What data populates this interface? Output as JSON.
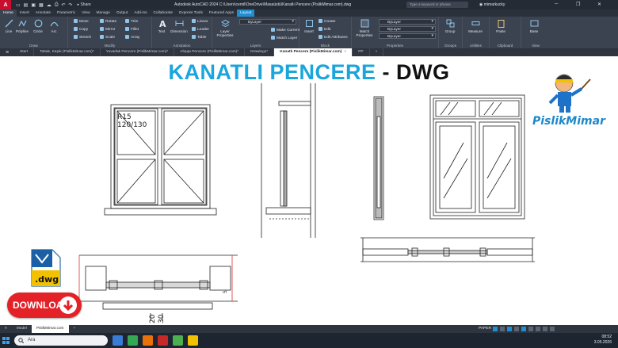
{
  "app": {
    "window_title": "Autodesk AutoCAD 2024   C:\\Users\\cemil\\OneDrive\\Masaüstü\\Kanatlı Pencere (PislikMimar.com).dwg",
    "search_placeholder": "Type a keyword or phrase",
    "user": "mimarkucky",
    "share_label": "Share",
    "logo_letter": "A"
  },
  "ribbon_tabs": [
    "Home",
    "Insert",
    "Annotate",
    "Parametric",
    "View",
    "Manage",
    "Output",
    "Add-ins",
    "Collaborate",
    "Express Tools",
    "Featured Apps",
    "Layout"
  ],
  "ribbon": {
    "draw": {
      "title": "Draw",
      "buttons": [
        "Line",
        "Polyline",
        "Circle",
        "Arc"
      ]
    },
    "modify": {
      "title": "Modify",
      "buttons": [
        "Move",
        "Rotate",
        "Trim",
        "Copy",
        "Mirror",
        "Fillet",
        "Stretch",
        "Scale",
        "Array"
      ]
    },
    "annotation": {
      "title": "Annotation",
      "buttons": [
        "Text",
        "Dimension",
        "Linear",
        "Leader",
        "Table"
      ]
    },
    "layers": {
      "title": "Layers",
      "buttons": [
        "Layer Properties",
        "Make Current",
        "Match Layer"
      ]
    },
    "block": {
      "title": "Block",
      "buttons": [
        "Insert",
        "Create",
        "Edit",
        "Edit Attributes"
      ]
    },
    "properties": {
      "title": "Properties",
      "buttons": [
        "Match Properties"
      ],
      "fields": [
        "ByLayer",
        "ByLayer",
        "ByLayer"
      ]
    },
    "groups": {
      "title": "Groups",
      "buttons": [
        "Group"
      ]
    },
    "utilities": {
      "title": "Utilities",
      "buttons": [
        "Measure"
      ]
    },
    "clipboard": {
      "title": "Clipboard",
      "buttons": [
        "Paste"
      ]
    },
    "view": {
      "title": "View",
      "buttons": [
        "Base"
      ]
    }
  },
  "doc_tabs": [
    {
      "label": "Start",
      "active": false
    },
    {
      "label": "Tabak, Kaşık (PislikMimar.com)*",
      "active": false
    },
    {
      "label": "Yuvarlak Pencere (PislikMimar.com)*",
      "active": false
    },
    {
      "label": "Ahşap Pencere (PislikMimar.com)*",
      "active": false
    },
    {
      "label": "Drawing1*",
      "active": false
    },
    {
      "label": "Kanatlı Pencere (PislikMimar.com)",
      "active": true
    },
    {
      "label": "PP",
      "active": false
    }
  ],
  "overlay": {
    "title_main": "KANATLI PENCERE",
    "title_sep": " - ",
    "title_format": "DWG",
    "dwg_label": ".dwg",
    "download_label": "DOWNLOAD",
    "brand": "PislikMimar"
  },
  "drawing": {
    "label_r": "R15",
    "label_size": "120/130",
    "dim_5": "5",
    "dim_20": "20",
    "dim_30": "30"
  },
  "model_tabs": [
    {
      "label": "Model",
      "active": false
    },
    {
      "label": "PislikMimar.com",
      "active": true
    }
  ],
  "status": {
    "space": "PAPER"
  },
  "taskbar": {
    "search_placeholder": "Ara",
    "time": "08:52",
    "date": "3.05.2026"
  },
  "colors": {
    "accent": "#1f8fd1",
    "title_blue": "#1aa6dd",
    "download_red": "#e32127",
    "ribbon_bg": "#3b4350"
  }
}
